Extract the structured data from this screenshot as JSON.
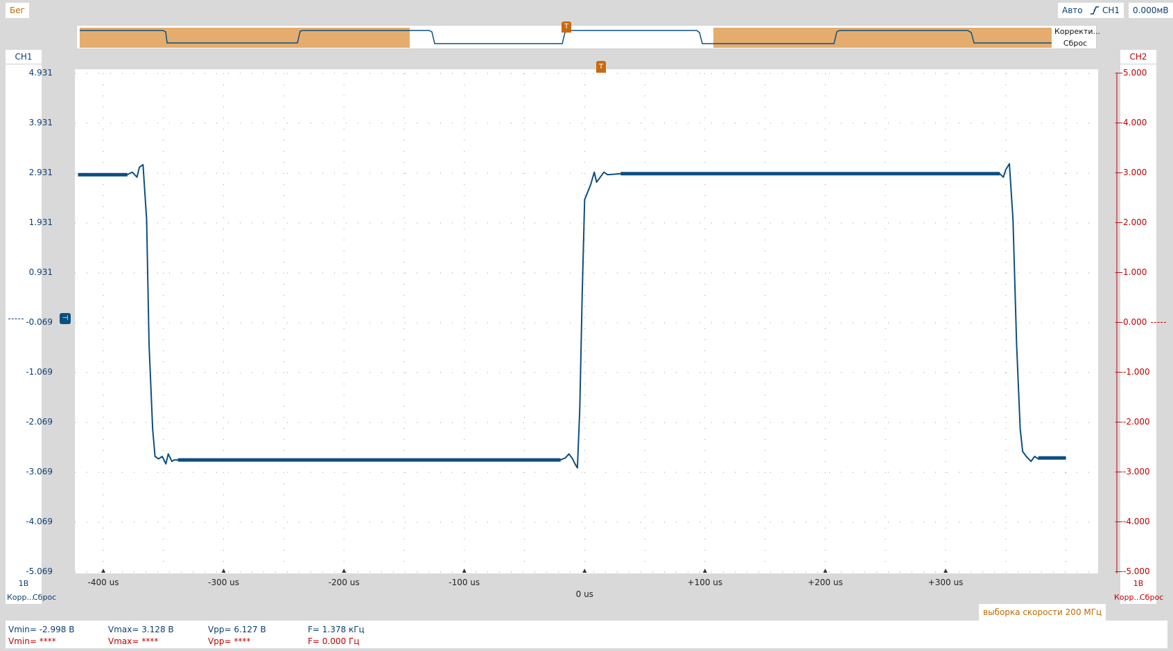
{
  "status": {
    "run": "Бег",
    "mode": "Авто",
    "trigger_source": "CH1",
    "trigger_level": "0.000мВ"
  },
  "overview": {
    "correction_label": "Корректи...",
    "reset_label": "Сброс",
    "trigger_marker": "T"
  },
  "ch1": {
    "label": "CH1",
    "scale": "1В",
    "correction": "Корр...",
    "reset": "Сброс",
    "ticks": [
      "4.931",
      "3.931",
      "2.931",
      "1.931",
      "0.931",
      "-0.069",
      "-1.069",
      "-2.069",
      "-3.069",
      "-4.069",
      "-5.069"
    ],
    "color": "#0b4f80"
  },
  "ch2": {
    "label": "CH2",
    "scale": "1В",
    "correction": "Корр...",
    "reset": "Сброс",
    "ticks": [
      "5.000",
      "4.000",
      "3.000",
      "2.000",
      "1.000",
      "0.000",
      "-1.000",
      "-2.000",
      "-3.000",
      "-4.000",
      "-5.000"
    ],
    "color": "#c00000"
  },
  "time_axis": {
    "labels": [
      "-400 us",
      "-300 us",
      "-200 us",
      "-100 us",
      "0 us",
      "+100 us",
      "+200 us",
      "+300 us"
    ],
    "trigger_marker": "T"
  },
  "sample_rate_label": "выборка скорости 200 МГц",
  "measurements": {
    "ch1": {
      "vmin": "Vmin= -2.998 В",
      "vmax": "Vmax= 3.128 В",
      "vpp": "Vpp= 6.127 В",
      "freq": "F= 1.378 кГц"
    },
    "ch2": {
      "vmin": "Vmin= ****",
      "vmax": "Vmax= ****",
      "vpp": "Vpp= ****",
      "freq": "F= 0.000 Гц"
    }
  },
  "chart_data": {
    "type": "line",
    "x_unit": "us",
    "y_unit": "В",
    "xlim": [
      -421,
      400
    ],
    "ylim": [
      -5.069,
      4.931
    ],
    "series": [
      {
        "name": "CH1",
        "x": [
          -421,
          -380,
          -376,
          -372,
          -370,
          -367,
          -364,
          -362,
          -359,
          -357,
          -354,
          -351,
          -348,
          -346,
          -343,
          -341,
          -338,
          -20,
          -16,
          -13,
          -10,
          -8,
          -6,
          -4,
          -2,
          0,
          5,
          8,
          10,
          13,
          16,
          19,
          30,
          345,
          348,
          350,
          353,
          356,
          359,
          362,
          364,
          367,
          371,
          374,
          377,
          400
        ],
        "y": [
          2.9,
          2.9,
          2.95,
          2.85,
          3.05,
          3.1,
          2.0,
          -0.5,
          -2.2,
          -2.75,
          -2.8,
          -2.75,
          -2.9,
          -2.7,
          -2.85,
          -2.82,
          -2.82,
          -2.82,
          -2.78,
          -2.7,
          -2.8,
          -2.9,
          -2.98,
          -1.8,
          0.5,
          2.4,
          2.7,
          2.95,
          2.75,
          2.85,
          2.95,
          2.9,
          2.92,
          2.92,
          2.85,
          3.0,
          3.12,
          2.0,
          -0.5,
          -2.2,
          -2.65,
          -2.75,
          -2.85,
          -2.75,
          -2.8,
          -2.78
        ]
      }
    ]
  }
}
